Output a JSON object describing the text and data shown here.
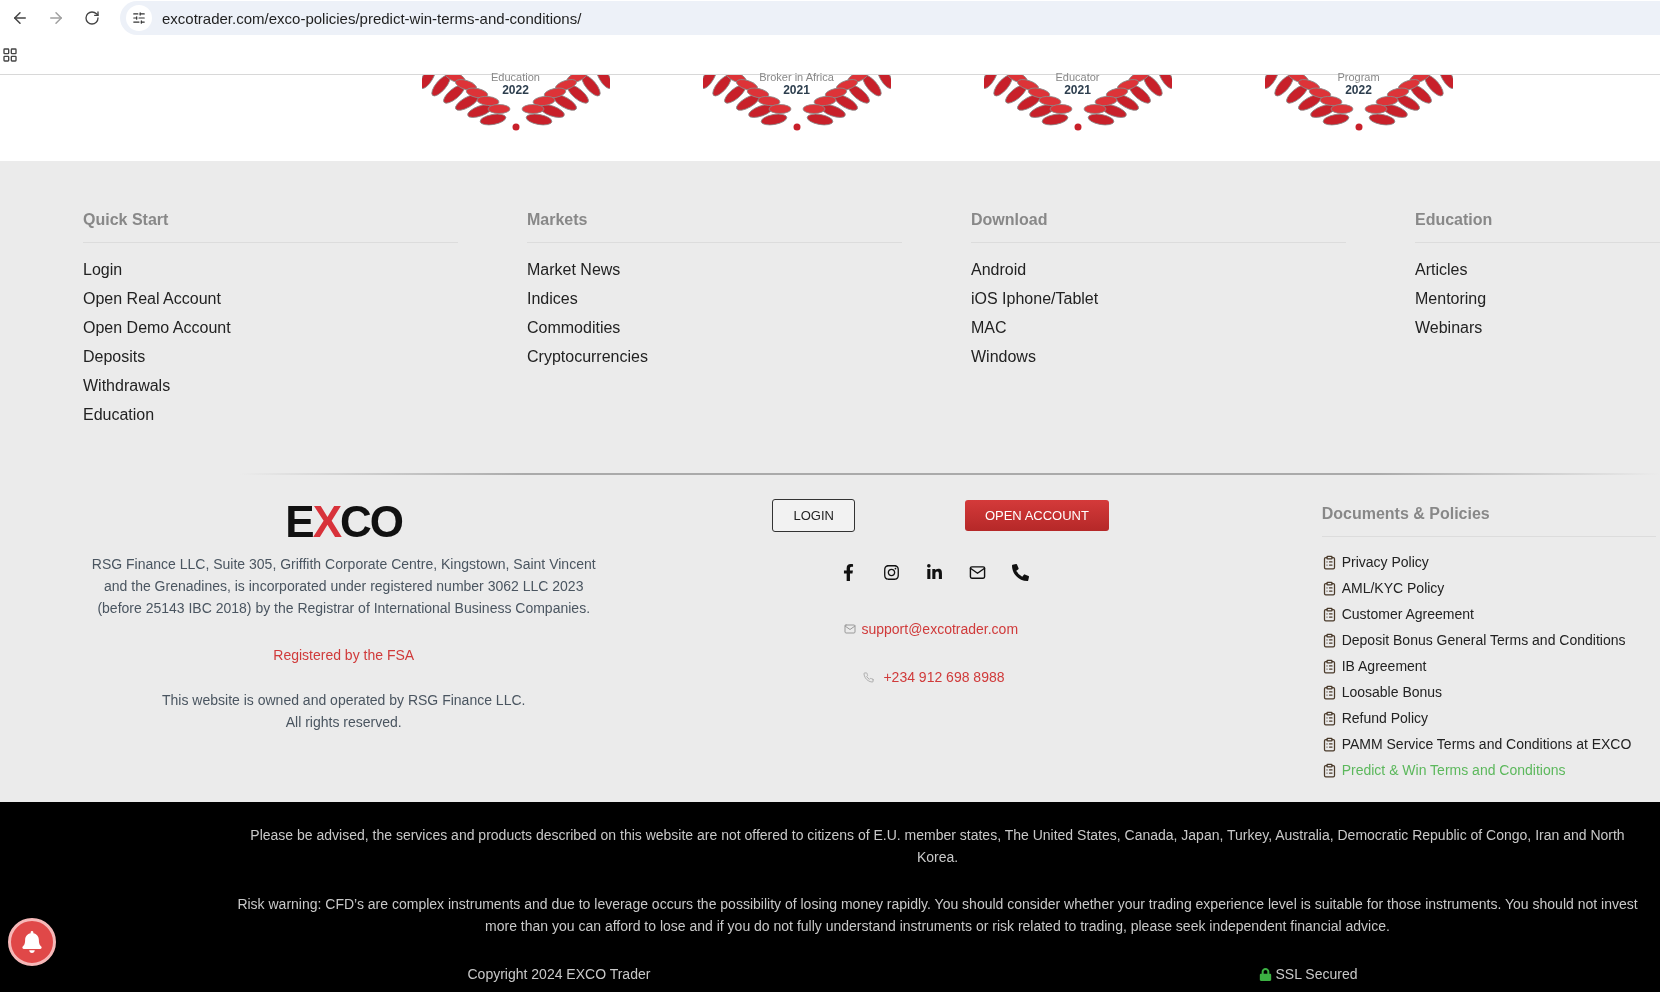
{
  "browser": {
    "url": "excotrader.com/exco-policies/predict-win-terms-and-conditions/"
  },
  "awards": [
    {
      "title": "Education",
      "year": "2022"
    },
    {
      "title": "Broker in Africa",
      "year": "2021"
    },
    {
      "title": "Educator",
      "year": "2021"
    },
    {
      "title": "Program",
      "year": "2022"
    }
  ],
  "columns": [
    {
      "heading": "Quick Start",
      "links": [
        "Login",
        "Open Real Account",
        "Open Demo Account",
        "Deposits",
        "Withdrawals",
        "Education"
      ]
    },
    {
      "heading": "Markets",
      "links": [
        "Market News",
        "Indices",
        "Commodities",
        "Cryptocurrencies"
      ]
    },
    {
      "heading": "Download",
      "links": [
        "Android",
        "iOS Iphone/Tablet",
        "MAC",
        "Windows"
      ]
    },
    {
      "heading": "Education",
      "links": [
        "Articles",
        "Mentoring",
        "Webinars"
      ]
    }
  ],
  "company": {
    "logo": {
      "left": "E",
      "accent": "X",
      "right": "CO"
    },
    "address": "RSG Finance LLC, Suite 305, Griffith Corporate Centre, Kingstown, Saint Vincent and the Grenadines, is incorporated under registered number 3062 LLC 2023 (before 25143 IBC 2018) by the Registrar of International Business Companies.",
    "registered": "Registered by the FSA",
    "ownership": [
      "This website is owned and operated by RSG Finance LLC.",
      "All rights reserved."
    ]
  },
  "buttons": [
    {
      "kind": "outline",
      "label": "LOGIN"
    },
    {
      "kind": "filled",
      "label": "OPEN ACCOUNT"
    }
  ],
  "contact": {
    "email": "support@excotrader.com",
    "phone": "+234 912 698 8988"
  },
  "documents": {
    "heading": "Documents & Policies",
    "items": [
      {
        "label": "Privacy Policy",
        "selected": false
      },
      {
        "label": "AML/KYC Policy",
        "selected": false
      },
      {
        "label": "Customer Agreement",
        "selected": false
      },
      {
        "label": "Deposit Bonus General Terms and Conditions",
        "selected": false
      },
      {
        "label": "IB Agreement",
        "selected": false
      },
      {
        "label": "Loosable Bonus",
        "selected": false
      },
      {
        "label": "Refund Policy",
        "selected": false
      },
      {
        "label": "PAMM Service Terms and Conditions at EXCO",
        "selected": false
      },
      {
        "label": "Predict & Win Terms and Conditions",
        "selected": true
      }
    ]
  },
  "disclaimer": {
    "notice": "Please be advised, the services and products described on this website are not offered to citizens of E.U. member states, The United States, Canada, Japan, Turkey, Australia, Democratic Republic of Congo, Iran and North Korea.",
    "risk_warning": "Risk warning: CFD’s are complex instruments and due to leverage occurs the possibility of losing money rapidly. You should consider whether your trading experience level is suitable for those instruments. You should not invest more than you can afford to lose and if you do not fully understand instruments or risk related to trading, please seek independent financial advice."
  },
  "bottom": {
    "copyright": "Copyright 2024 EXCO Trader",
    "ssl": "SSL Secured"
  }
}
